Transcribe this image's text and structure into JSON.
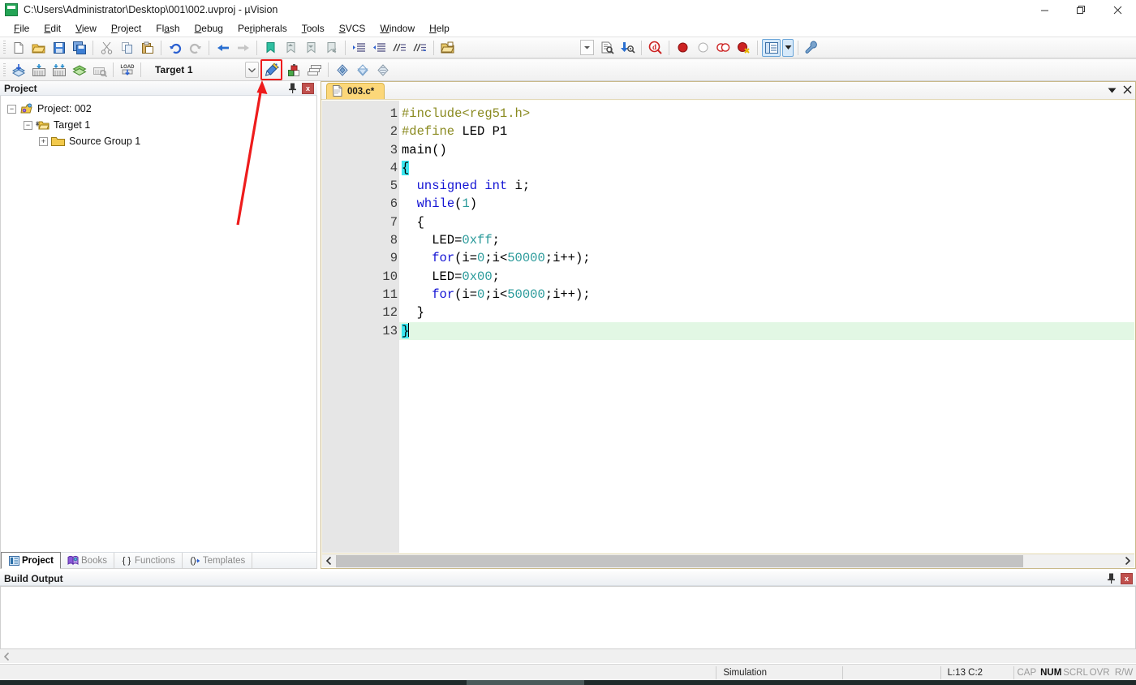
{
  "window": {
    "title": "C:\\Users\\Administrator\\Desktop\\001\\002.uvproj - µVision",
    "logo_icon": "uvision-logo-icon",
    "minimize_icon": "minimize-icon",
    "restore_icon": "restore-icon",
    "close_icon": "close-icon"
  },
  "menubar": {
    "items": [
      {
        "label": "File",
        "accel": "F"
      },
      {
        "label": "Edit",
        "accel": "E"
      },
      {
        "label": "View",
        "accel": "V"
      },
      {
        "label": "Project",
        "accel": "P"
      },
      {
        "label": "Flash",
        "accel": "a"
      },
      {
        "label": "Debug",
        "accel": "D"
      },
      {
        "label": "Peripherals",
        "accel": "r"
      },
      {
        "label": "Tools",
        "accel": "T"
      },
      {
        "label": "SVCS",
        "accel": "S"
      },
      {
        "label": "Window",
        "accel": "W"
      },
      {
        "label": "Help",
        "accel": "H"
      }
    ]
  },
  "toolbar_file": {
    "buttons": [
      {
        "name": "new-file-icon",
        "title": "New"
      },
      {
        "name": "open-file-icon",
        "title": "Open"
      },
      {
        "name": "save-icon",
        "title": "Save"
      },
      {
        "name": "save-all-icon",
        "title": "Save All"
      },
      {
        "name": "cut-icon",
        "title": "Cut"
      },
      {
        "name": "copy-icon",
        "title": "Copy"
      },
      {
        "name": "paste-icon",
        "title": "Paste"
      },
      {
        "name": "undo-icon",
        "title": "Undo"
      },
      {
        "name": "redo-icon",
        "title": "Redo"
      },
      {
        "name": "navigate-back-icon",
        "title": "Back"
      },
      {
        "name": "navigate-forward-icon",
        "title": "Forward"
      },
      {
        "name": "bookmark-toggle-icon",
        "title": "Insert/Remove Bookmark"
      },
      {
        "name": "bookmark-prev-icon",
        "title": "Previous Bookmark"
      },
      {
        "name": "bookmark-next-icon",
        "title": "Next Bookmark"
      },
      {
        "name": "bookmark-clear-icon",
        "title": "Clear All Bookmarks"
      },
      {
        "name": "indent-increase-icon",
        "title": "Indent"
      },
      {
        "name": "indent-decrease-icon",
        "title": "Outdent"
      },
      {
        "name": "comment-icon",
        "title": "Comment"
      },
      {
        "name": "uncomment-icon",
        "title": "Uncomment"
      },
      {
        "name": "open-folder-icon",
        "title": "Open Folder"
      }
    ],
    "right_buttons": [
      {
        "name": "combo-dropdown-icon",
        "title": "Find combo"
      },
      {
        "name": "find-in-files-icon",
        "title": "Find in Files"
      },
      {
        "name": "find-next-icon",
        "title": "Find Next"
      },
      {
        "name": "quick-find-icon",
        "title": "Incremental Find"
      },
      {
        "name": "insert-breakpoint-icon",
        "title": "Insert/Remove Breakpoint"
      },
      {
        "name": "disable-breakpoint-icon",
        "title": "Enable/Disable Breakpoint"
      },
      {
        "name": "disable-all-breakpoints-icon",
        "title": "Disable All Breakpoints"
      },
      {
        "name": "kill-all-breakpoints-icon",
        "title": "Kill All Breakpoints"
      },
      {
        "name": "window-layout-icon",
        "title": "Window Layout"
      },
      {
        "name": "layout-dropdown-icon",
        "title": "Layout Dropdown"
      },
      {
        "name": "configure-tools-icon",
        "title": "Configuration Wizard"
      }
    ]
  },
  "toolbar_build": {
    "buttons": [
      {
        "name": "translate-file-icon",
        "title": "Translate"
      },
      {
        "name": "build-target-icon",
        "title": "Build"
      },
      {
        "name": "rebuild-all-icon",
        "title": "Rebuild All"
      },
      {
        "name": "batch-build-icon",
        "title": "Batch Build"
      },
      {
        "name": "stop-build-icon",
        "title": "Stop Build"
      },
      {
        "name": "download-icon",
        "title": "Download"
      }
    ],
    "target_value": "Target 1",
    "target_dropdown_icon": "chevron-down-icon",
    "right_buttons": [
      {
        "name": "options-for-target-icon",
        "title": "Options for Target",
        "highlighted": true
      },
      {
        "name": "manage-run-time-env-icon",
        "title": "Manage Run-Time Environment"
      },
      {
        "name": "manage-project-items-icon",
        "title": "Manage Project Items"
      },
      {
        "name": "svcs-checkin-icon",
        "title": "Check In"
      },
      {
        "name": "svcs-checkout-icon",
        "title": "Check Out"
      },
      {
        "name": "svcs-undo-checkout-icon",
        "title": "Undo Check Out"
      }
    ]
  },
  "project_panel": {
    "title": "Project",
    "pin_icon": "pin-icon",
    "close_icon": "close-icon",
    "tree": [
      {
        "label": "Project: 002",
        "expander": "minus",
        "icon": "project-icon",
        "indent": 0
      },
      {
        "label": "Target 1",
        "expander": "minus",
        "icon": "target-folder-icon",
        "indent": 1
      },
      {
        "label": "Source Group 1",
        "expander": "plus",
        "icon": "folder-icon",
        "indent": 2
      }
    ],
    "tabs": [
      {
        "label": "Project",
        "icon": "project-tab-icon",
        "active": true
      },
      {
        "label": "Books",
        "icon": "books-icon",
        "active": false
      },
      {
        "label": "Functions",
        "icon": "functions-icon",
        "active": false
      },
      {
        "label": "Templates",
        "icon": "templates-icon",
        "active": false
      }
    ]
  },
  "editor": {
    "tab_label": "003.c*",
    "tab_icon": "document-icon",
    "dropdown_icon": "chevron-down-icon",
    "close_icon": "close-icon",
    "scroll_left_icon": "chevron-left-icon",
    "scroll_right_icon": "chevron-right-icon",
    "line_numbers": [
      "1",
      "2",
      "3",
      "4",
      "5",
      "6",
      "7",
      "8",
      "9",
      "10",
      "11",
      "12",
      "13"
    ],
    "current_line": 13,
    "code_lines": [
      "#include<reg51.h>",
      "#define LED P1",
      "main()",
      "{",
      "  unsigned int i;",
      "  while(1)",
      "  {",
      "    LED=0xff;",
      "    for(i=0;i<50000;i++);",
      "    LED=0x00;",
      "    for(i=0;i<50000;i++);",
      "  }",
      "}"
    ]
  },
  "build_output": {
    "title": "Build Output",
    "content": "",
    "scroll_left_icon": "chevron-left-icon"
  },
  "statusbar": {
    "simulation": "Simulation",
    "position": "L:13 C:2",
    "indicators": [
      {
        "label": "CAP",
        "active": false
      },
      {
        "label": "NUM",
        "active": true
      },
      {
        "label": "SCRL",
        "active": false
      },
      {
        "label": "OVR",
        "active": false
      },
      {
        "label": "R/W",
        "active": false
      }
    ]
  },
  "annotation": {
    "arrow_color": "#ee1c1c",
    "highlight_color": "#ee1c1c",
    "target": "options-for-target-icon"
  },
  "colors": {
    "preprocessor": "#8a8a20",
    "keyword": "#1414d4",
    "number": "#2a9a9a",
    "current_line_bg": "#e2f7e4",
    "brace_highlight": "#3ce6ef",
    "editor_border": "#c9b98a",
    "tab_bg": "#fcd779"
  }
}
